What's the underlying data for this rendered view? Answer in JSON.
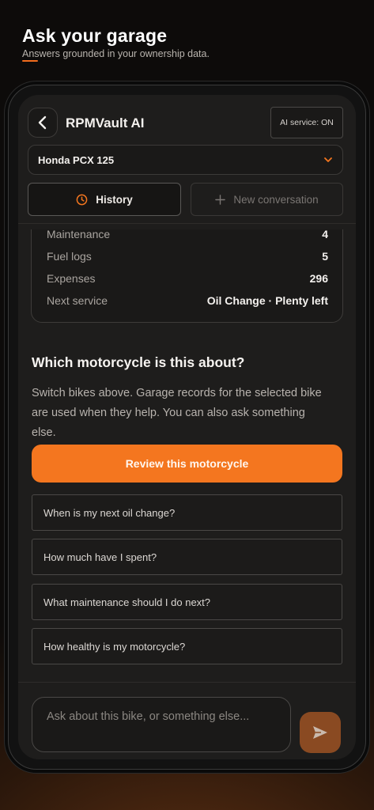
{
  "promo": {
    "title": "Ask your garage",
    "subtitle": "Answers grounded in your ownership data."
  },
  "header": {
    "back_icon": "chevron-left-icon",
    "title": "RPMVault AI",
    "ai_status": "AI service: ON"
  },
  "bike_selector": {
    "selected": "Honda PCX 125",
    "icon": "chevron-down-icon"
  },
  "actions": {
    "history_label": "History",
    "history_icon": "clock-icon",
    "new_conversation_label": "New conversation",
    "new_conversation_icon": "plus-icon"
  },
  "stats": [
    {
      "label": "Maintenance",
      "value": "4"
    },
    {
      "label": "Fuel logs",
      "value": "5"
    },
    {
      "label": "Expenses",
      "value": "296"
    },
    {
      "label": "Next service",
      "value": "Oil Change · Plenty left"
    }
  ],
  "prompt": {
    "question": "Which motorcycle is this about?",
    "description": "Switch bikes above. Garage records for the selected bike are used when they help. You can also ask something else.",
    "review_button": "Review this motorcycle"
  },
  "suggestions": [
    "When is my next oil change?",
    "How much have I spent?",
    "What maintenance should I do next?",
    "How healthy is my motorcycle?"
  ],
  "composer": {
    "placeholder": "Ask about this bike, or something else...",
    "send_icon": "send-icon"
  },
  "colors": {
    "accent": "#f4761f",
    "background": "#1e1d1c"
  }
}
